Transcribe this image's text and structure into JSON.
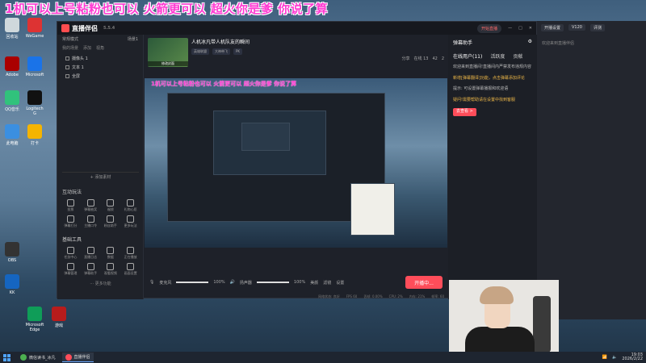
{
  "banner": {
    "text": "1机可以上号粘粉也可以 火箭更可以 超火你是爹 你说了算"
  },
  "desktop": {
    "icons": [
      {
        "label": "回收站",
        "color": "#cfd8dc"
      },
      {
        "label": "WeGame",
        "color": "#d33"
      },
      {
        "label": "Adobe",
        "color": "#a00"
      },
      {
        "label": "Microsoft",
        "color": "#1a73e8"
      },
      {
        "label": "QQ音乐",
        "color": "#31c27c"
      },
      {
        "label": "Logitech G",
        "color": "#111"
      },
      {
        "label": "此电脑",
        "color": "#3b8fe0"
      },
      {
        "label": "打卡",
        "color": "#f5b400"
      },
      {
        "label": "OBS",
        "color": "#333"
      },
      {
        "label": "KK",
        "color": "#1565c0"
      },
      {
        "label": "Microsoft Edge",
        "color": "#0f9d58"
      },
      {
        "label": "游戏",
        "color": "#b71c1c"
      }
    ]
  },
  "app": {
    "name": "直播伴侣",
    "version": "5.5.4",
    "live_pill": "开始直播",
    "left": {
      "section_title": "常规模式",
      "scene_label": "场景1",
      "scene_tabs": [
        "我的场景",
        "添加",
        "视角"
      ],
      "sources": [
        "摄像头 1",
        "文本 1",
        "全屏"
      ],
      "add_source": "+ 添加素材",
      "interactive_title": "互动玩法",
      "interactive_tools": [
        "投票",
        "弹幕抽奖",
        "福袋",
        "礼物心愿",
        "弹幕打分",
        "主播口令",
        "粉丝助手",
        "更多玩法"
      ],
      "basic_title": "基础工具",
      "basic_tools": [
        "任务中心",
        "直播日志",
        "数据",
        "正在播放",
        "弹幕管理",
        "弹幕助手",
        "观看视频",
        "画面设置"
      ],
      "more": "··· 更多功能"
    },
    "stream": {
      "thumb_label": "修改封面",
      "title": "人机冰凡带人机队友的瞬间",
      "tags": [
        "英雄联盟",
        "大神带飞",
        "PK"
      ],
      "share": "分享",
      "stats": [
        "在线 13",
        "42",
        "2"
      ]
    },
    "controls": {
      "mic_label": "麦克风",
      "mic_value": "100%",
      "speaker_label": "扬声器",
      "speaker_value": "100%",
      "effects": [
        "美颜",
        "滤镜",
        "设置"
      ],
      "go_live": "开播中..."
    },
    "statusbar": [
      "网络状态: 良好",
      "FPS 60",
      "丢帧: 0.00%",
      "CPU: 2%",
      "内存: 21%",
      "帧率: 60"
    ],
    "right": {
      "title": "弹幕助手",
      "tabs": [
        "在线用户(11)",
        "活跃度",
        "贡献"
      ],
      "messages": [
        {
          "text": "欢迎来到直播间!直播间内严禁发布违规内容",
          "hi": false
        },
        {
          "text": "新增[弹幕翻译]功能，点击弹幕添加评论",
          "hi": true
        },
        {
          "text": "提示: 可设置弹幕播报和欢迎语",
          "hi": false
        },
        {
          "text": "疑问!需要帮助请在设置中找到客服",
          "hi": true
        }
      ],
      "more_btn": "去查看 >"
    }
  },
  "far_right": {
    "buttons": [
      "开播设置",
      "V120",
      "评测"
    ],
    "tips": "欢迎来到直播伴侣"
  },
  "taskbar": {
    "tasks": [
      "微信读书_冰凡",
      "直播伴侣"
    ],
    "time": "19:03",
    "date": "2026/2/22"
  }
}
